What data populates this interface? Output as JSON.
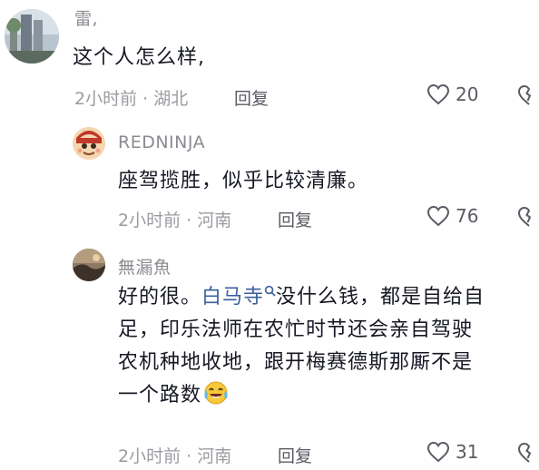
{
  "comments": [
    {
      "author": "雷,",
      "text": "这个人怎么样,",
      "time_location": "2小时前 · 湖北",
      "reply_label": "回复",
      "likes": "20"
    },
    {
      "author": "REDNINJA",
      "text": "座驾揽胜，似乎比较清廉。",
      "time_location": "2小时前 · 河南",
      "reply_label": "回复",
      "likes": "76"
    },
    {
      "author": "無漏魚",
      "text_before_link": "好的很。",
      "link_text": "白马寺",
      "text_after_link_line1": "没什么钱，都是自给自",
      "text_line2": "足，印乐法师在农忙时节还会亲自驾驶",
      "text_line3": "农机种地收地，跟开梅赛德斯那厮不是",
      "text_line4": "一个路数",
      "time_location": "2小时前 · 河南",
      "reply_label": "回复",
      "likes": "31"
    }
  ],
  "icons": {
    "like": "heart-outline-icon",
    "dislike": "broken-heart-icon",
    "link_search": "search-icon",
    "emoji": "laughing-tears-emoji"
  },
  "colors": {
    "link": "#3a5f9b",
    "meta": "#9b9ca1",
    "text": "#161823"
  }
}
